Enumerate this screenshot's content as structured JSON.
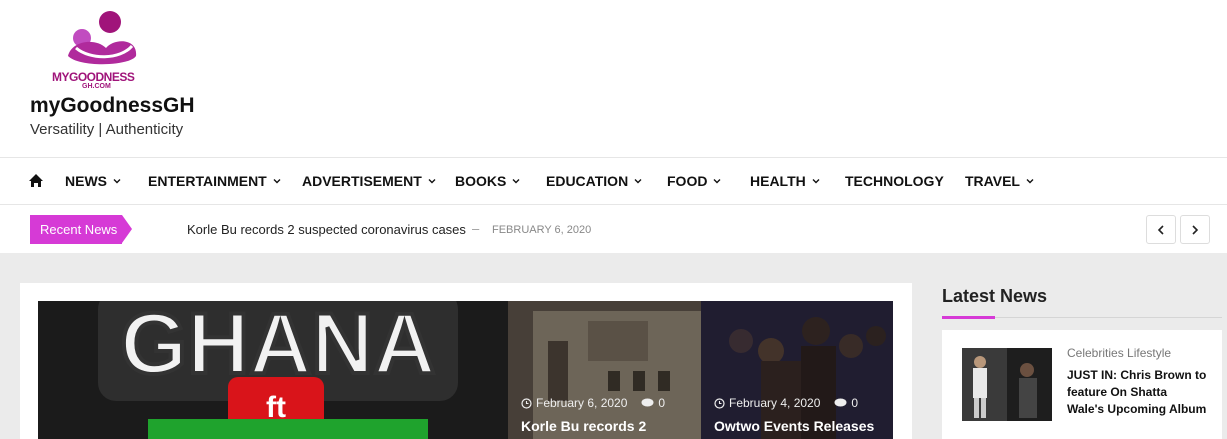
{
  "brand": {
    "logo_text": "MYGOODNESS",
    "logo_subtext": "GH.COM",
    "site_title": "myGoodnessGH",
    "tagline": "Versatility | Authenticity",
    "accent_color": "#d63ad6",
    "logo_color": "#a0147a"
  },
  "nav": {
    "home_icon": "home-icon",
    "items": [
      {
        "label": "NEWS",
        "has_dropdown": true
      },
      {
        "label": "ENTERTAINMENT",
        "has_dropdown": true
      },
      {
        "label": "ADVERTISEMENT",
        "has_dropdown": true
      },
      {
        "label": "BOOKS",
        "has_dropdown": true
      },
      {
        "label": "EDUCATION",
        "has_dropdown": true
      },
      {
        "label": "FOOD",
        "has_dropdown": true
      },
      {
        "label": "HEALTH",
        "has_dropdown": true
      },
      {
        "label": "TECHNOLOGY",
        "has_dropdown": false
      },
      {
        "label": "TRAVEL",
        "has_dropdown": true
      }
    ]
  },
  "ticker": {
    "label": "Recent News",
    "headline": "Korle Bu records 2 suspected coronavirus cases",
    "separator": "–",
    "date": "FEBRUARY 6, 2020",
    "prev_icon": "chevron-left-icon",
    "next_icon": "chevron-right-icon"
  },
  "featured": {
    "main_image_text": {
      "top": "GHANA",
      "middle": "ft"
    },
    "posts": [
      {
        "date": "February 6, 2020",
        "comments": "0",
        "title": "Korle Bu records 2"
      },
      {
        "date": "February 4, 2020",
        "comments": "0",
        "title": "Owtwo Events Releases"
      }
    ]
  },
  "sidebar": {
    "title": "Latest News",
    "post": {
      "category": "Celebrities Lifestyle",
      "headline": "JUST IN: Chris Brown to feature On Shatta Wale's Upcoming Album"
    }
  }
}
